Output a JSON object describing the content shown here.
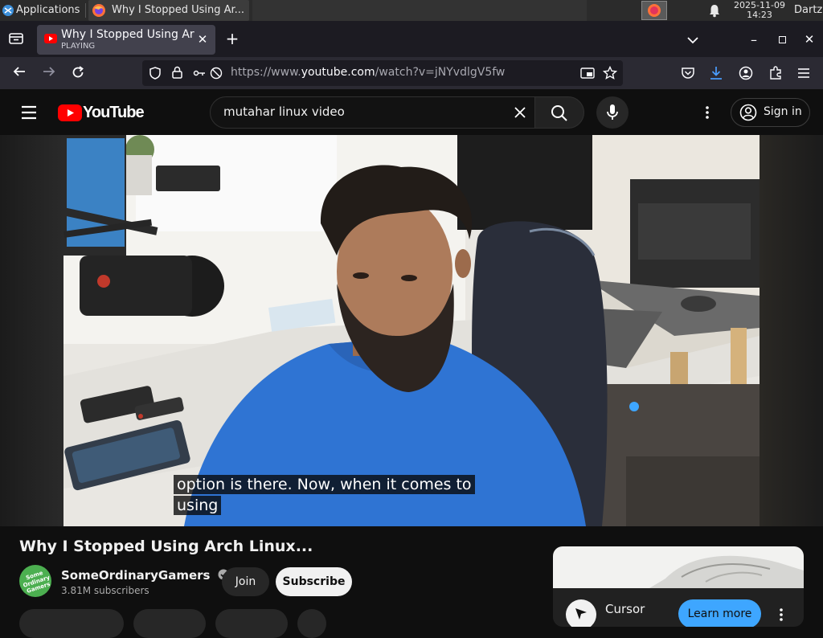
{
  "taskbar": {
    "applications_label": "Applications",
    "window_title": "Why I Stopped Using Ar...",
    "date": "2025-11-09",
    "time": "14:23",
    "user": "Dartz"
  },
  "browser": {
    "tab_title": "Why I Stopped Using Arc",
    "tab_status": "PLAYING",
    "url_prefix": "https://www.",
    "url_domain": "youtube.com",
    "url_path": "/watch?v=jNYvdlgV5fw"
  },
  "youtube": {
    "logo_text": "YouTube",
    "search_value": "mutahar linux video",
    "sign_in_label": "Sign in",
    "caption_line1": "option is there. Now, when it comes to",
    "caption_line2": "using",
    "video_title": "Why I Stopped Using Arch Linux...",
    "channel_name": "SomeOrdinaryGamers",
    "subscribers": "3.81M subscribers",
    "join_label": "Join",
    "subscribe_label": "Subscribe",
    "avatar_text": "Some Ordinary Gamers"
  },
  "ad": {
    "name": "Cursor",
    "learn_more": "Learn more"
  },
  "colors": {
    "youtube_red": "#ff0000",
    "background": "#0f0f0f",
    "learn_more_blue": "#3ea6ff"
  }
}
